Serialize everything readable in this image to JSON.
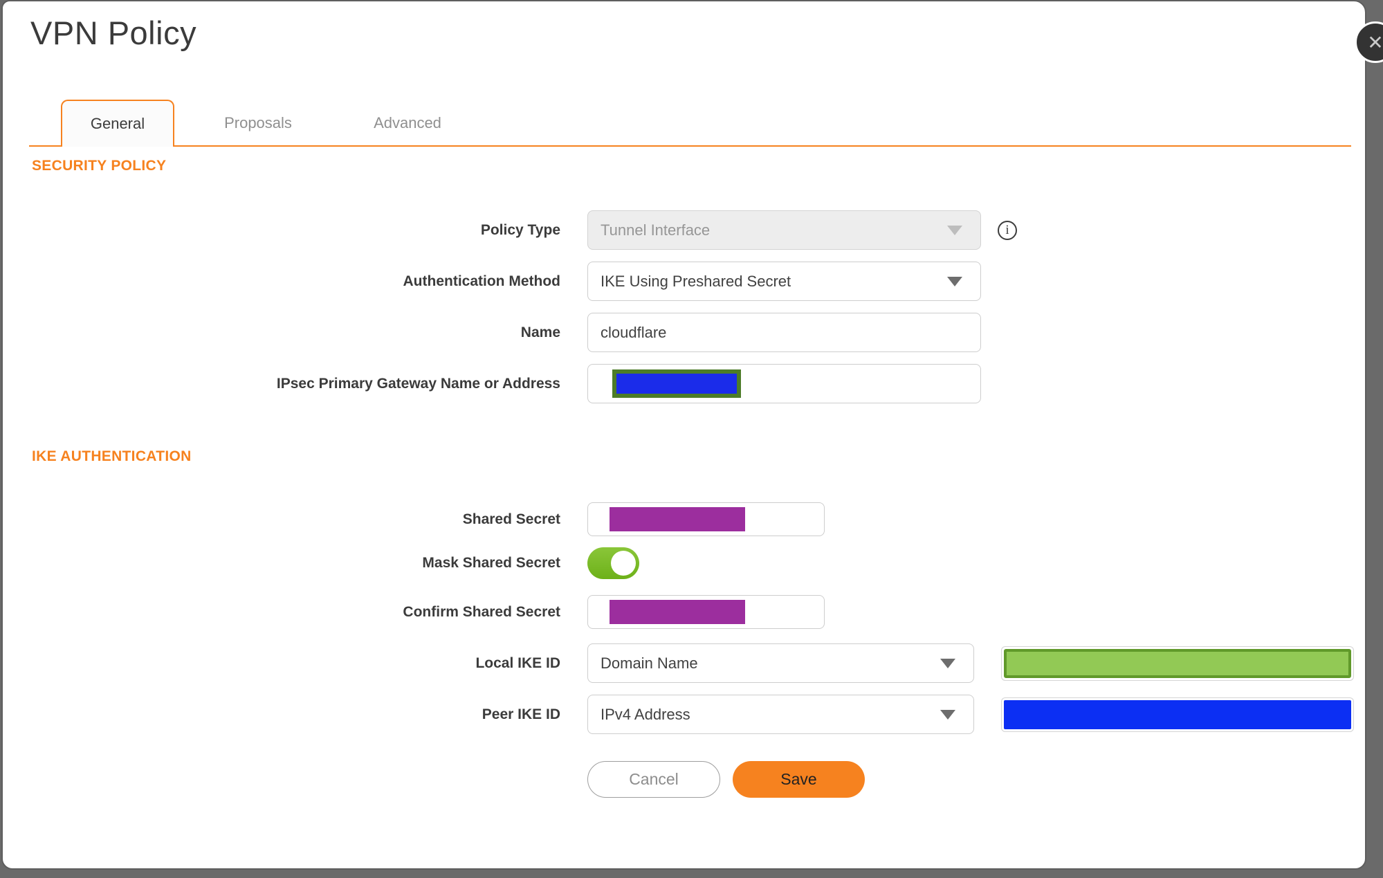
{
  "dialog": {
    "title": "VPN Policy",
    "close_glyph": "✕"
  },
  "tabs": [
    {
      "label": "General",
      "active": true
    },
    {
      "label": "Proposals",
      "active": false
    },
    {
      "label": "Advanced",
      "active": false
    }
  ],
  "sections": {
    "security_policy": "SECURITY POLICY",
    "ike_authentication": "IKE AUTHENTICATION"
  },
  "fields": {
    "policy_type": {
      "label": "Policy Type",
      "value": "Tunnel Interface",
      "disabled": true
    },
    "authentication_method": {
      "label": "Authentication Method",
      "value": "IKE Using Preshared Secret"
    },
    "name": {
      "label": "Name",
      "value": "cloudflare"
    },
    "gateway": {
      "label": "IPsec Primary Gateway Name or Address",
      "value_redacted": true
    },
    "shared_secret": {
      "label": "Shared Secret",
      "value_redacted": true
    },
    "mask_shared_secret": {
      "label": "Mask Shared Secret",
      "enabled": true
    },
    "confirm_shared_secret": {
      "label": "Confirm Shared Secret",
      "value_redacted": true
    },
    "local_ike_id": {
      "label": "Local IKE ID",
      "value": "Domain Name",
      "id_value_redacted": true
    },
    "peer_ike_id": {
      "label": "Peer IKE ID",
      "value": "IPv4 Address",
      "id_value_redacted": true
    }
  },
  "icons": {
    "info_glyph": "i"
  },
  "buttons": {
    "cancel": "Cancel",
    "save": "Save"
  },
  "colors": {
    "accent_orange": "#F6821F",
    "title_text": "#3B3B3B",
    "inactive_tab_text": "#8F8F8F",
    "disabled_field_bg": "#EDEDED",
    "disabled_field_text": "#969696",
    "field_border": "#CDCDCD",
    "redaction_gateway_blue": "#1B2CEA",
    "redaction_gateway_border": "#4D7C28",
    "redaction_purple": "#9C2E9E",
    "redaction_local_green": "#92C955",
    "redaction_local_green_border": "#60992A",
    "redaction_peer_blue": "#0C2FF3",
    "toggle_on_green": "#7ABD27",
    "backdrop_gray": "#6A6A6A"
  }
}
